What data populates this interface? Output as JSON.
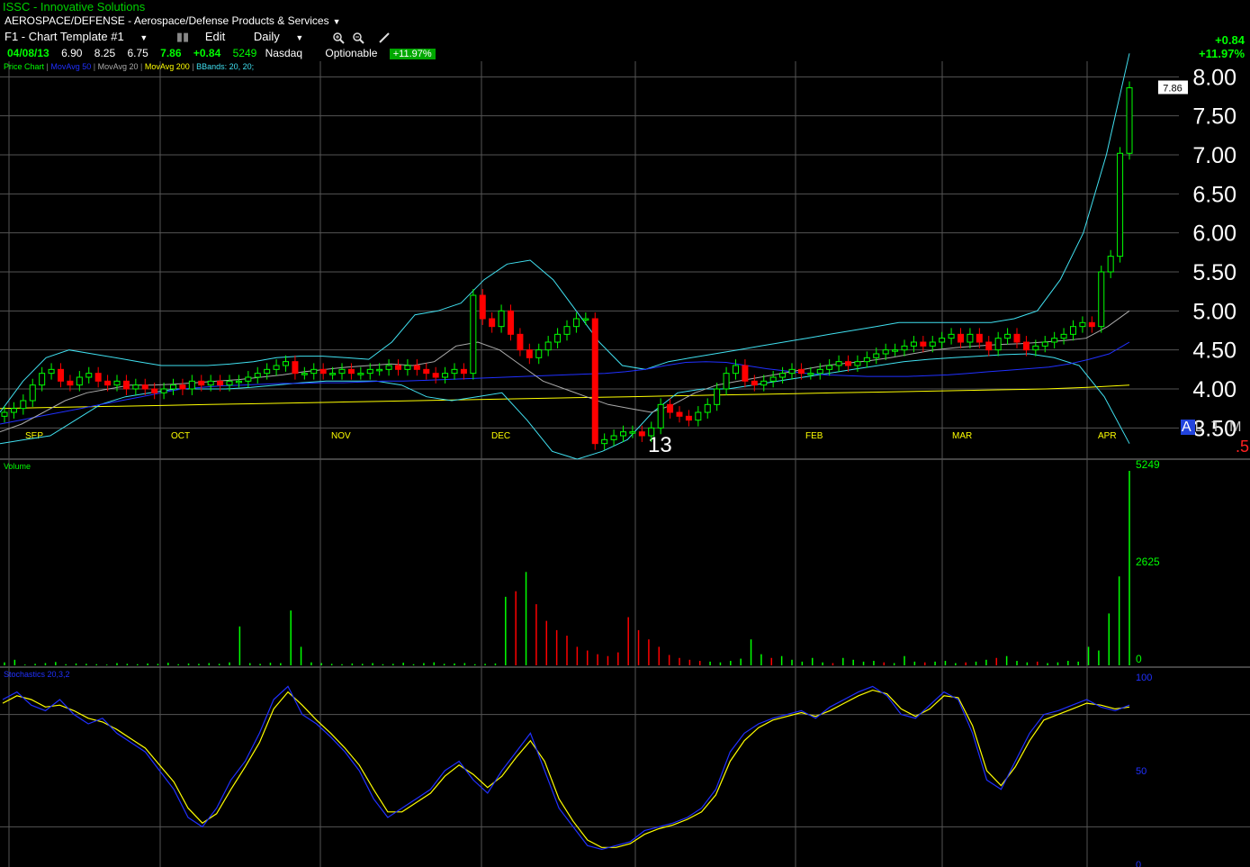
{
  "header": {
    "title": "ISSC - Innovative Solutions",
    "sector": "AEROSPACE/DEFENSE - Aerospace/Defense Products & Services"
  },
  "toolbar": {
    "template": "F1 - Chart Template #1",
    "edit": "Edit",
    "period": "Daily"
  },
  "quote": {
    "date": "04/08/13",
    "open": "6.90",
    "high": "8.25",
    "low": "6.75",
    "close": "7.86",
    "change": "+0.84",
    "volume": "5249",
    "exchange": "Nasdaq",
    "optionable": "Optionable",
    "pct": "+11.97%"
  },
  "legend": {
    "price_chart": "Price Chart",
    "ma50": "MovAvg 50",
    "ma20": "MovAvg 20",
    "ma200": "MovAvg 200",
    "bbands": "BBands: 20, 20;",
    "volume": "Volume",
    "stoch": "Stochastics 20,3,2"
  },
  "change_top": "+0.84",
  "change_bottom": "+11.97%",
  "price_label": "7.86",
  "year_marker": "13",
  "timeframes": {
    "selected": "A",
    "others": "L T M L"
  },
  "red_marker": ".5",
  "colors": {
    "up": "#00ff00",
    "down": "#ff0000",
    "ma50": "#2030ff",
    "ma20": "#aaaaaa",
    "ma200": "#ffff00",
    "bbands": "#40e0f0",
    "grid": "#555555",
    "month": "#ffff00"
  },
  "chart_data": [
    {
      "type": "candlestick",
      "title": "Price Chart",
      "x": [
        "SEP",
        "OCT",
        "NOV",
        "DEC",
        "13",
        "FEB",
        "MAR",
        "APR"
      ],
      "ylim": [
        3.1,
        8.2
      ],
      "y_ticks": [
        "3.50",
        "4.00",
        "4.50",
        "5.00",
        "5.50",
        "6.00",
        "6.50",
        "7.00",
        "7.50",
        "8.00"
      ],
      "last_price": 7.86,
      "closes": [
        3.7,
        3.75,
        3.85,
        4.05,
        4.2,
        4.25,
        4.1,
        4.05,
        4.15,
        4.2,
        4.1,
        4.05,
        4.1,
        4.0,
        4.05,
        4.0,
        3.95,
        4.0,
        4.05,
        4.0,
        4.1,
        4.05,
        4.1,
        4.05,
        4.1,
        4.1,
        4.15,
        4.2,
        4.25,
        4.3,
        4.35,
        4.2,
        4.2,
        4.25,
        4.2,
        4.2,
        4.25,
        4.2,
        4.2,
        4.25,
        4.25,
        4.3,
        4.25,
        4.3,
        4.25,
        4.2,
        4.15,
        4.2,
        4.25,
        4.2,
        5.2,
        4.9,
        4.8,
        5.0,
        4.7,
        4.5,
        4.4,
        4.5,
        4.6,
        4.7,
        4.8,
        4.9,
        4.9,
        3.3,
        3.35,
        3.4,
        3.45,
        3.45,
        3.4,
        3.5,
        3.8,
        3.7,
        3.65,
        3.6,
        3.7,
        3.8,
        4.0,
        4.2,
        4.3,
        4.1,
        4.05,
        4.1,
        4.15,
        4.2,
        4.25,
        4.2,
        4.2,
        4.25,
        4.3,
        4.35,
        4.3,
        4.35,
        4.4,
        4.45,
        4.5,
        4.5,
        4.55,
        4.6,
        4.55,
        4.6,
        4.65,
        4.7,
        4.6,
        4.7,
        4.6,
        4.5,
        4.65,
        4.7,
        4.6,
        4.5,
        4.55,
        4.6,
        4.65,
        4.7,
        4.8,
        4.85,
        4.8,
        5.5,
        5.7,
        7.02,
        7.86
      ],
      "ma50": [
        3.55,
        3.6,
        3.65,
        3.7,
        3.75,
        3.8,
        3.85,
        3.9,
        3.95,
        4.0,
        4.02,
        4.04,
        4.05,
        4.06,
        4.07,
        4.07,
        4.08,
        4.08,
        4.09,
        4.1,
        4.1,
        4.11,
        4.12,
        4.13,
        4.14,
        4.15,
        4.16,
        4.17,
        4.18,
        4.19,
        4.2,
        4.22,
        4.25,
        4.3,
        4.34,
        4.35,
        4.34,
        4.3,
        4.26,
        4.23,
        4.2,
        4.18,
        4.17,
        4.16,
        4.16,
        4.16,
        4.17,
        4.18,
        4.2,
        4.22,
        4.24,
        4.26,
        4.28,
        4.32,
        4.38,
        4.45,
        4.6
      ],
      "ma20": [
        3.45,
        3.55,
        3.7,
        3.85,
        3.95,
        4.0,
        4.05,
        4.05,
        4.06,
        4.08,
        4.1,
        4.12,
        4.15,
        4.18,
        4.22,
        4.25,
        4.28,
        4.3,
        4.32,
        4.3,
        4.35,
        4.55,
        4.6,
        4.5,
        4.3,
        4.1,
        4.0,
        3.9,
        3.8,
        3.75,
        3.7,
        3.8,
        3.95,
        4.05,
        4.1,
        4.15,
        4.2,
        4.25,
        4.3,
        4.33,
        4.36,
        4.4,
        4.45,
        4.5,
        4.53,
        4.55,
        4.57,
        4.58,
        4.6,
        4.62,
        4.65,
        4.8,
        5.0
      ],
      "ma200": [
        3.75,
        3.76,
        3.77,
        3.78,
        3.79,
        3.8,
        3.81,
        3.82,
        3.83,
        3.84,
        3.85,
        3.86,
        3.87,
        3.88,
        3.89,
        3.9,
        3.91,
        3.92,
        3.93,
        3.94,
        3.95,
        3.96,
        3.97,
        3.98,
        3.99,
        4.0,
        4.02,
        4.05
      ],
      "bb_upper": [
        3.7,
        4.1,
        4.4,
        4.5,
        4.45,
        4.4,
        4.35,
        4.3,
        4.3,
        4.3,
        4.32,
        4.35,
        4.4,
        4.42,
        4.42,
        4.4,
        4.38,
        4.6,
        4.95,
        5.0,
        5.1,
        5.4,
        5.6,
        5.65,
        5.4,
        5.0,
        4.6,
        4.3,
        4.25,
        4.35,
        4.4,
        4.45,
        4.5,
        4.55,
        4.6,
        4.65,
        4.7,
        4.75,
        4.8,
        4.85,
        4.85,
        4.85,
        4.85,
        4.85,
        4.9,
        5.0,
        5.4,
        6.0,
        7.0,
        8.3
      ],
      "bb_lower": [
        3.3,
        3.35,
        3.4,
        3.6,
        3.8,
        3.9,
        3.95,
        4.0,
        4.0,
        4.0,
        4.02,
        4.05,
        4.08,
        4.1,
        4.1,
        4.1,
        4.05,
        3.9,
        3.85,
        3.9,
        3.95,
        3.6,
        3.2,
        3.1,
        3.2,
        3.35,
        3.7,
        3.95,
        4.0,
        4.0,
        4.05,
        4.1,
        4.15,
        4.2,
        4.25,
        4.3,
        4.35,
        4.38,
        4.4,
        4.42,
        4.44,
        4.45,
        4.4,
        4.3,
        3.9,
        3.3
      ]
    },
    {
      "type": "bar",
      "title": "Volume",
      "y_ticks": [
        "0",
        "2625",
        "5249"
      ],
      "ylim": [
        0,
        5249
      ],
      "values": [
        80,
        150,
        20,
        40,
        60,
        90,
        30,
        50,
        40,
        30,
        20,
        60,
        40,
        30,
        50,
        40,
        70,
        30,
        50,
        40,
        60,
        40,
        80,
        1050,
        60,
        40,
        70,
        60,
        1480,
        500,
        80,
        60,
        40,
        30,
        50,
        40,
        60,
        30,
        40,
        70,
        30,
        60,
        80,
        40,
        50,
        60,
        30,
        40,
        50,
        1850,
        2000,
        2520,
        1650,
        1200,
        950,
        800,
        500,
        400,
        300,
        250,
        350,
        1300,
        950,
        700,
        500,
        280,
        200,
        150,
        120,
        100,
        80,
        120,
        180,
        700,
        300,
        200,
        250,
        150,
        100,
        200,
        80,
        60,
        200,
        150,
        100,
        120,
        80,
        60,
        250,
        100,
        80,
        100,
        120,
        60,
        80,
        100,
        150,
        200,
        250,
        120,
        80,
        100,
        60,
        80,
        120,
        100,
        500,
        400,
        1400,
        2400,
        5249
      ],
      "down_flags": [
        0,
        0,
        0,
        0,
        0,
        0,
        0,
        0,
        0,
        0,
        0,
        0,
        0,
        0,
        0,
        0,
        0,
        0,
        0,
        0,
        0,
        0,
        0,
        0,
        0,
        0,
        0,
        0,
        0,
        0,
        0,
        0,
        0,
        0,
        0,
        0,
        0,
        0,
        0,
        0,
        0,
        0,
        0,
        0,
        0,
        0,
        0,
        0,
        0,
        0,
        1,
        0,
        1,
        1,
        1,
        1,
        1,
        1,
        1,
        1,
        1,
        1,
        1,
        1,
        1,
        1,
        1,
        1,
        1,
        0,
        0,
        0,
        0,
        0,
        0,
        1,
        0,
        0,
        0,
        0,
        0,
        1,
        0,
        0,
        0,
        0,
        1,
        0,
        0,
        0,
        1,
        0,
        0,
        0,
        1,
        0,
        0,
        1,
        0,
        0,
        0,
        1,
        0,
        0,
        0,
        0,
        0,
        0,
        0,
        0,
        0,
        0
      ]
    },
    {
      "type": "line",
      "title": "Stochastics 20,3,2",
      "ylim": [
        0,
        100
      ],
      "y_ticks": [
        "0",
        "50",
        "100"
      ],
      "series": [
        {
          "name": "k",
          "values": [
            88,
            92,
            85,
            82,
            88,
            80,
            75,
            78,
            70,
            65,
            60,
            50,
            40,
            25,
            20,
            30,
            45,
            55,
            70,
            88,
            95,
            80,
            75,
            68,
            60,
            50,
            35,
            25,
            30,
            35,
            40,
            50,
            55,
            45,
            38,
            50,
            60,
            70,
            50,
            30,
            20,
            10,
            8,
            10,
            12,
            18,
            20,
            22,
            25,
            30,
            40,
            60,
            70,
            75,
            78,
            80,
            82,
            78,
            84,
            88,
            92,
            95,
            90,
            80,
            78,
            85,
            92,
            88,
            70,
            45,
            40,
            55,
            70,
            80,
            82,
            85,
            88,
            84,
            82,
            85
          ]
        },
        {
          "name": "d",
          "values": [
            86,
            90,
            88,
            84,
            85,
            82,
            78,
            76,
            72,
            67,
            62,
            53,
            44,
            30,
            22,
            27,
            40,
            52,
            65,
            83,
            92,
            85,
            77,
            70,
            62,
            53,
            40,
            28,
            28,
            33,
            38,
            47,
            53,
            48,
            41,
            47,
            57,
            66,
            55,
            35,
            23,
            13,
            9,
            9,
            11,
            16,
            19,
            21,
            24,
            28,
            37,
            55,
            66,
            73,
            77,
            79,
            81,
            79,
            82,
            86,
            90,
            93,
            91,
            83,
            79,
            83,
            90,
            89,
            74,
            50,
            42,
            52,
            66,
            77,
            80,
            83,
            86,
            85,
            83,
            84
          ]
        }
      ]
    }
  ]
}
